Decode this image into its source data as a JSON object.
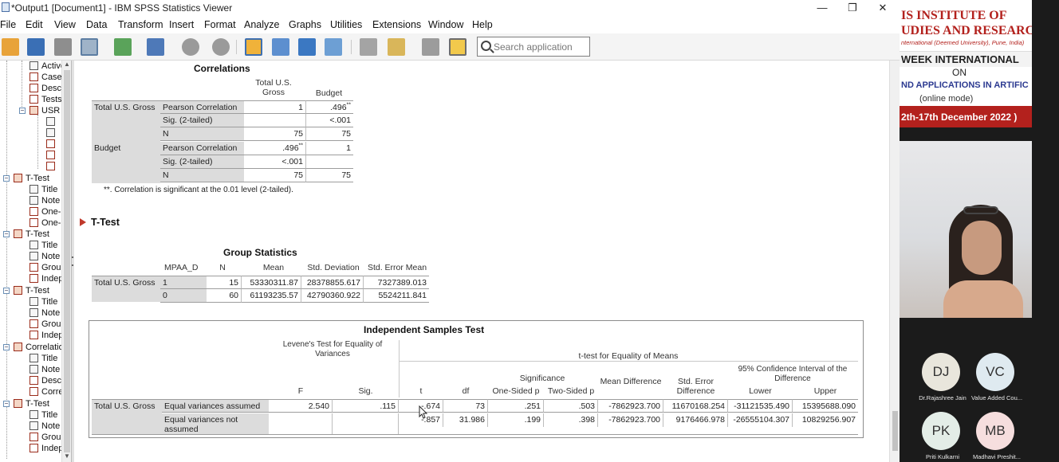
{
  "window": {
    "title": "*Output1 [Document1] - IBM SPSS Statistics Viewer",
    "minimize": "—",
    "restore": "❐",
    "close": "✕"
  },
  "menu": [
    "File",
    "Edit",
    "View",
    "Data",
    "Transform",
    "Insert",
    "Format",
    "Analyze",
    "Graphs",
    "Utilities",
    "Extensions",
    "Window",
    "Help"
  ],
  "search": {
    "placeholder": "Search application"
  },
  "toolbar_icons": [
    "open-icon",
    "save-icon",
    "print-icon",
    "print-preview-icon",
    "export-icon",
    "recall-dialog-icon",
    "undo-icon",
    "redo-icon",
    "goto-data-icon",
    "goto-case-icon",
    "goto-variable-icon",
    "variables-icon",
    "designated-window-icon",
    "show-all-icon",
    "create-title-icon",
    "insert-output-icon"
  ],
  "outline": {
    "items": [
      {
        "label": "Active",
        "icon": "doc"
      },
      {
        "label": "Case",
        "icon": "red"
      },
      {
        "label": "Desc",
        "icon": "red"
      },
      {
        "label": "Tests",
        "icon": "red"
      },
      {
        "label": "USR",
        "icon": "red"
      },
      {
        "label": "T-Test",
        "icon": "red"
      },
      {
        "label": "Title",
        "icon": "doc"
      },
      {
        "label": "Note",
        "icon": "doc"
      },
      {
        "label": "One-",
        "icon": "rb"
      },
      {
        "label": "One-",
        "icon": "rb"
      },
      {
        "label": "T-Test",
        "icon": "red"
      },
      {
        "label": "Title",
        "icon": "doc"
      },
      {
        "label": "Note",
        "icon": "doc"
      },
      {
        "label": "Grou",
        "icon": "rb"
      },
      {
        "label": "Indep",
        "icon": "rb"
      },
      {
        "label": "T-Test",
        "icon": "red"
      },
      {
        "label": "Title",
        "icon": "doc"
      },
      {
        "label": "Note",
        "icon": "doc"
      },
      {
        "label": "Grou",
        "icon": "rb"
      },
      {
        "label": "Indep",
        "icon": "rb"
      },
      {
        "label": "Correlatio",
        "icon": "red"
      },
      {
        "label": "Title",
        "icon": "doc"
      },
      {
        "label": "Note",
        "icon": "doc"
      },
      {
        "label": "Desc",
        "icon": "rb"
      },
      {
        "label": "Corre",
        "icon": "rb"
      },
      {
        "label": "T-Test",
        "icon": "red"
      },
      {
        "label": "Title",
        "icon": "doc"
      },
      {
        "label": "Note",
        "icon": "doc"
      },
      {
        "label": "Grou",
        "icon": "rb"
      },
      {
        "label": "Indep",
        "icon": "rb"
      }
    ]
  },
  "correlations": {
    "title": "Correlations",
    "col_headers": [
      "Total U.S. Gross",
      "Budget"
    ],
    "rows": [
      {
        "group": "Total U.S. Gross",
        "stat": "Pearson Correlation",
        "v1": "1",
        "v2": ".496",
        "v2sup": "**"
      },
      {
        "group": "",
        "stat": "Sig. (2-tailed)",
        "v1": "",
        "v2": "<.001",
        "v2sup": ""
      },
      {
        "group": "",
        "stat": "N",
        "v1": "75",
        "v2": "75",
        "v2sup": ""
      },
      {
        "group": "Budget",
        "stat": "Pearson Correlation",
        "v1": ".496",
        "v1sup": "**",
        "v2": "1",
        "v2sup": ""
      },
      {
        "group": "",
        "stat": "Sig. (2-tailed)",
        "v1": "<.001",
        "v2": "",
        "v2sup": ""
      },
      {
        "group": "",
        "stat": "N",
        "v1": "75",
        "v2": "75",
        "v2sup": ""
      }
    ],
    "footnote": "**. Correlation is significant at the 0.01 level (2-tailed)."
  },
  "ttest_heading": "T-Test",
  "group_stats": {
    "title": "Group Statistics",
    "headers": [
      "MPAA_D",
      "N",
      "Mean",
      "Std. Deviation",
      "Std. Error Mean"
    ],
    "row_label": "Total U.S. Gross",
    "rows": [
      [
        "1",
        "15",
        "53330311.87",
        "28378855.617",
        "7327389.013"
      ],
      [
        "0",
        "60",
        "61193235.57",
        "42790360.922",
        "5524211.841"
      ]
    ]
  },
  "ind_test": {
    "title": "Independent Samples Test",
    "levene": "Levene's Test for Equality of Variances",
    "ttest": "t-test for Equality of Means",
    "significance": "Significance",
    "ci": "95% Confidence Interval of the Difference",
    "headers": [
      "F",
      "Sig.",
      "t",
      "df",
      "One-Sided p",
      "Two-Sided p",
      "Mean Difference",
      "Std. Error Difference",
      "Lower",
      "Upper"
    ],
    "row_label": "Total U.S. Gross",
    "rows": [
      {
        "label": "Equal variances assumed",
        "values": [
          "2.540",
          ".115",
          "-.674",
          "73",
          ".251",
          ".503",
          "-7862923.700",
          "11670168.254",
          "-31121535.490",
          "15395688.090"
        ]
      },
      {
        "label": "Equal variances not assumed",
        "values": [
          "",
          "",
          "-.857",
          "31.986",
          ".199",
          ".398",
          "-7862923.700",
          "9176466.978",
          "-26555104.307",
          "10829256.907"
        ]
      }
    ]
  },
  "webinar": {
    "banner_line1": "IS INSTITUTE OF",
    "banner_line2": "UDIES AND RESEARCH",
    "banner_line3": "nternational (Deemed University), Pune, India)",
    "banner_line4": "WEEK INTERNATIONAL",
    "banner_line5": "ON",
    "banner_line6": "ND APPLICATIONS IN ARTIFIC",
    "banner_line7": "(online mode)",
    "banner_dates": "2th-17th December 2022 )",
    "participants": [
      {
        "initials": "DJ",
        "name": "Dr.Rajashree Jain",
        "color": "#e9e6dc"
      },
      {
        "initials": "VC",
        "name": "Value Added Cou...",
        "color": "#dfeaf0"
      },
      {
        "initials": "PK",
        "name": "Priti Kulkarni",
        "color": "#e3ede7"
      },
      {
        "initials": "MB",
        "name": "Madhavi Preshit...",
        "color": "#f6dede"
      }
    ]
  }
}
